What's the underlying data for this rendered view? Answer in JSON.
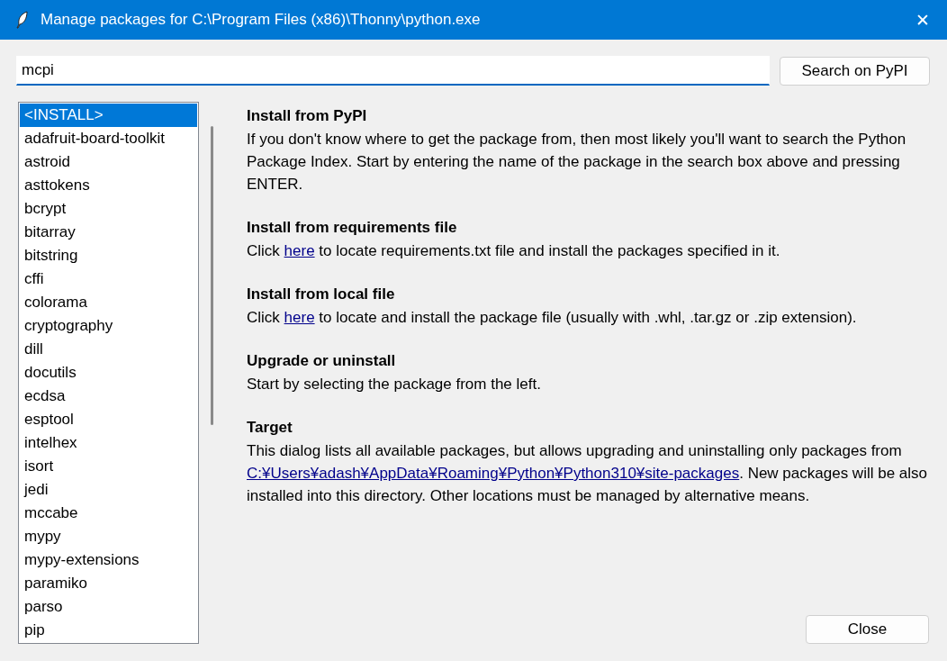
{
  "window": {
    "title": "Manage packages for C:\\Program Files (x86)\\Thonny\\python.exe",
    "close": "✕"
  },
  "search": {
    "value": "mcpi",
    "button": "Search on PyPI"
  },
  "packages": [
    {
      "name": "<INSTALL>",
      "selected": true
    },
    {
      "name": "adafruit-board-toolkit",
      "selected": false
    },
    {
      "name": "astroid",
      "selected": false
    },
    {
      "name": "asttokens",
      "selected": false
    },
    {
      "name": "bcrypt",
      "selected": false
    },
    {
      "name": "bitarray",
      "selected": false
    },
    {
      "name": "bitstring",
      "selected": false
    },
    {
      "name": "cffi",
      "selected": false
    },
    {
      "name": "colorama",
      "selected": false
    },
    {
      "name": "cryptography",
      "selected": false
    },
    {
      "name": "dill",
      "selected": false
    },
    {
      "name": "docutils",
      "selected": false
    },
    {
      "name": "ecdsa",
      "selected": false
    },
    {
      "name": "esptool",
      "selected": false
    },
    {
      "name": "intelhex",
      "selected": false
    },
    {
      "name": "isort",
      "selected": false
    },
    {
      "name": "jedi",
      "selected": false
    },
    {
      "name": "mccabe",
      "selected": false
    },
    {
      "name": "mypy",
      "selected": false
    },
    {
      "name": "mypy-extensions",
      "selected": false
    },
    {
      "name": "paramiko",
      "selected": false
    },
    {
      "name": "parso",
      "selected": false
    },
    {
      "name": "pip",
      "selected": false
    }
  ],
  "sections": [
    {
      "heading": "Install from PyPI",
      "body": [
        {
          "kind": "text",
          "text": "If you don't know where to get the package from, then most likely you'll want to search the Python Package Index. Start by entering the name of the package in the search box above and pressing ENTER."
        }
      ]
    },
    {
      "heading": "Install from requirements file",
      "body": [
        {
          "kind": "text",
          "text": "Click "
        },
        {
          "kind": "link",
          "text": "here"
        },
        {
          "kind": "text",
          "text": " to locate requirements.txt file and install the packages specified in it."
        }
      ]
    },
    {
      "heading": "Install from local file",
      "body": [
        {
          "kind": "text",
          "text": "Click "
        },
        {
          "kind": "link",
          "text": "here"
        },
        {
          "kind": "text",
          "text": " to locate and install the package file (usually with .whl, .tar.gz or .zip extension)."
        }
      ]
    },
    {
      "heading": "Upgrade or uninstall",
      "body": [
        {
          "kind": "text",
          "text": "Start by selecting the package from the left."
        }
      ]
    },
    {
      "heading": "Target",
      "body": [
        {
          "kind": "text",
          "text": "This dialog lists all available packages, but allows upgrading and uninstalling only packages from "
        },
        {
          "kind": "link",
          "text": "C:¥Users¥adash¥AppData¥Roaming¥Python¥Python310¥site-packages"
        },
        {
          "kind": "text",
          "text": ". New packages will be also installed into this directory. Other locations must be managed by alternative means."
        }
      ]
    }
  ],
  "close_button": "Close"
}
